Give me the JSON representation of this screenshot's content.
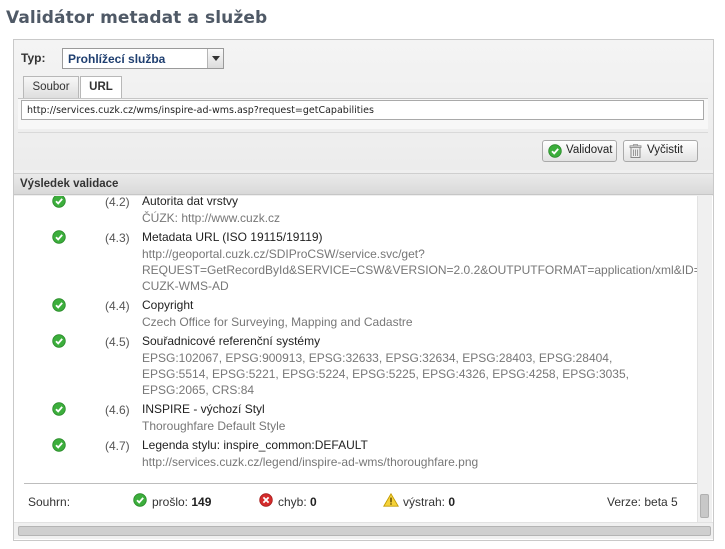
{
  "page": {
    "title": "Validátor metadat a služeb"
  },
  "form": {
    "type_label": "Typ:",
    "type_value": "Prohlížecí služba",
    "tabs": [
      {
        "label": "Soubor",
        "active": false
      },
      {
        "label": "URL",
        "active": true
      }
    ],
    "url_value": "http://services.cuzk.cz/wms/inspire-ad-wms.asp?request=getCapabilities",
    "validate_label": "Validovat",
    "clear_label": "Vyčistit"
  },
  "result": {
    "header": "Výsledek validace",
    "items": [
      {
        "num": "(4.2)",
        "title": "Autorita dat vrstvy",
        "value": "ČÚZK: http://www.cuzk.cz",
        "status": "ok"
      },
      {
        "num": "(4.3)",
        "title": "Metadata URL (ISO 19115/19119)",
        "value": "http://geoportal.cuzk.cz/SDIProCSW/service.svc/get?\nREQUEST=GetRecordById&SERVICE=CSW&VERSION=2.0.2&OUTPUTFORMAT=application/xml&ID=\nCUZK-WMS-AD",
        "status": "ok"
      },
      {
        "num": "(4.4)",
        "title": "Copyright",
        "value": "Czech Office for Surveying, Mapping and Cadastre",
        "status": "ok"
      },
      {
        "num": "(4.5)",
        "title": "Souřadnicové referenční systémy",
        "value": "EPSG:102067, EPSG:900913, EPSG:32633, EPSG:32634, EPSG:28403, EPSG:28404,\nEPSG:5514, EPSG:5221, EPSG:5224, EPSG:5225, EPSG:4326, EPSG:4258, EPSG:3035,\nEPSG:2065, CRS:84",
        "status": "ok"
      },
      {
        "num": "(4.6)",
        "title": "INSPIRE - výchozí Styl",
        "value": "Thoroughfare Default Style",
        "status": "ok"
      },
      {
        "num": "(4.7)",
        "title": "Legenda stylu: inspire_common:DEFAULT",
        "value": "http://services.cuzk.cz/legend/inspire-ad-wms/thoroughfare.png",
        "status": "ok"
      }
    ],
    "summary": {
      "label": "Souhrn:",
      "passed_label": "prošlo:",
      "passed": "149",
      "errors_label": "chyb:",
      "errors": "0",
      "warnings_label": "výstrah:",
      "warnings": "0",
      "version": "Verze: beta 5"
    }
  },
  "colors": {
    "ok": "#3cae3c",
    "error": "#d42b2b",
    "warning": "#e5b800",
    "title": "#4f5966"
  },
  "icons": {
    "ok": "check-circle-icon",
    "error": "x-circle-icon",
    "warning": "warning-triangle-icon",
    "validate": "check-circle-icon",
    "clear": "trash-icon",
    "dropdown": "chevron-down-icon"
  }
}
